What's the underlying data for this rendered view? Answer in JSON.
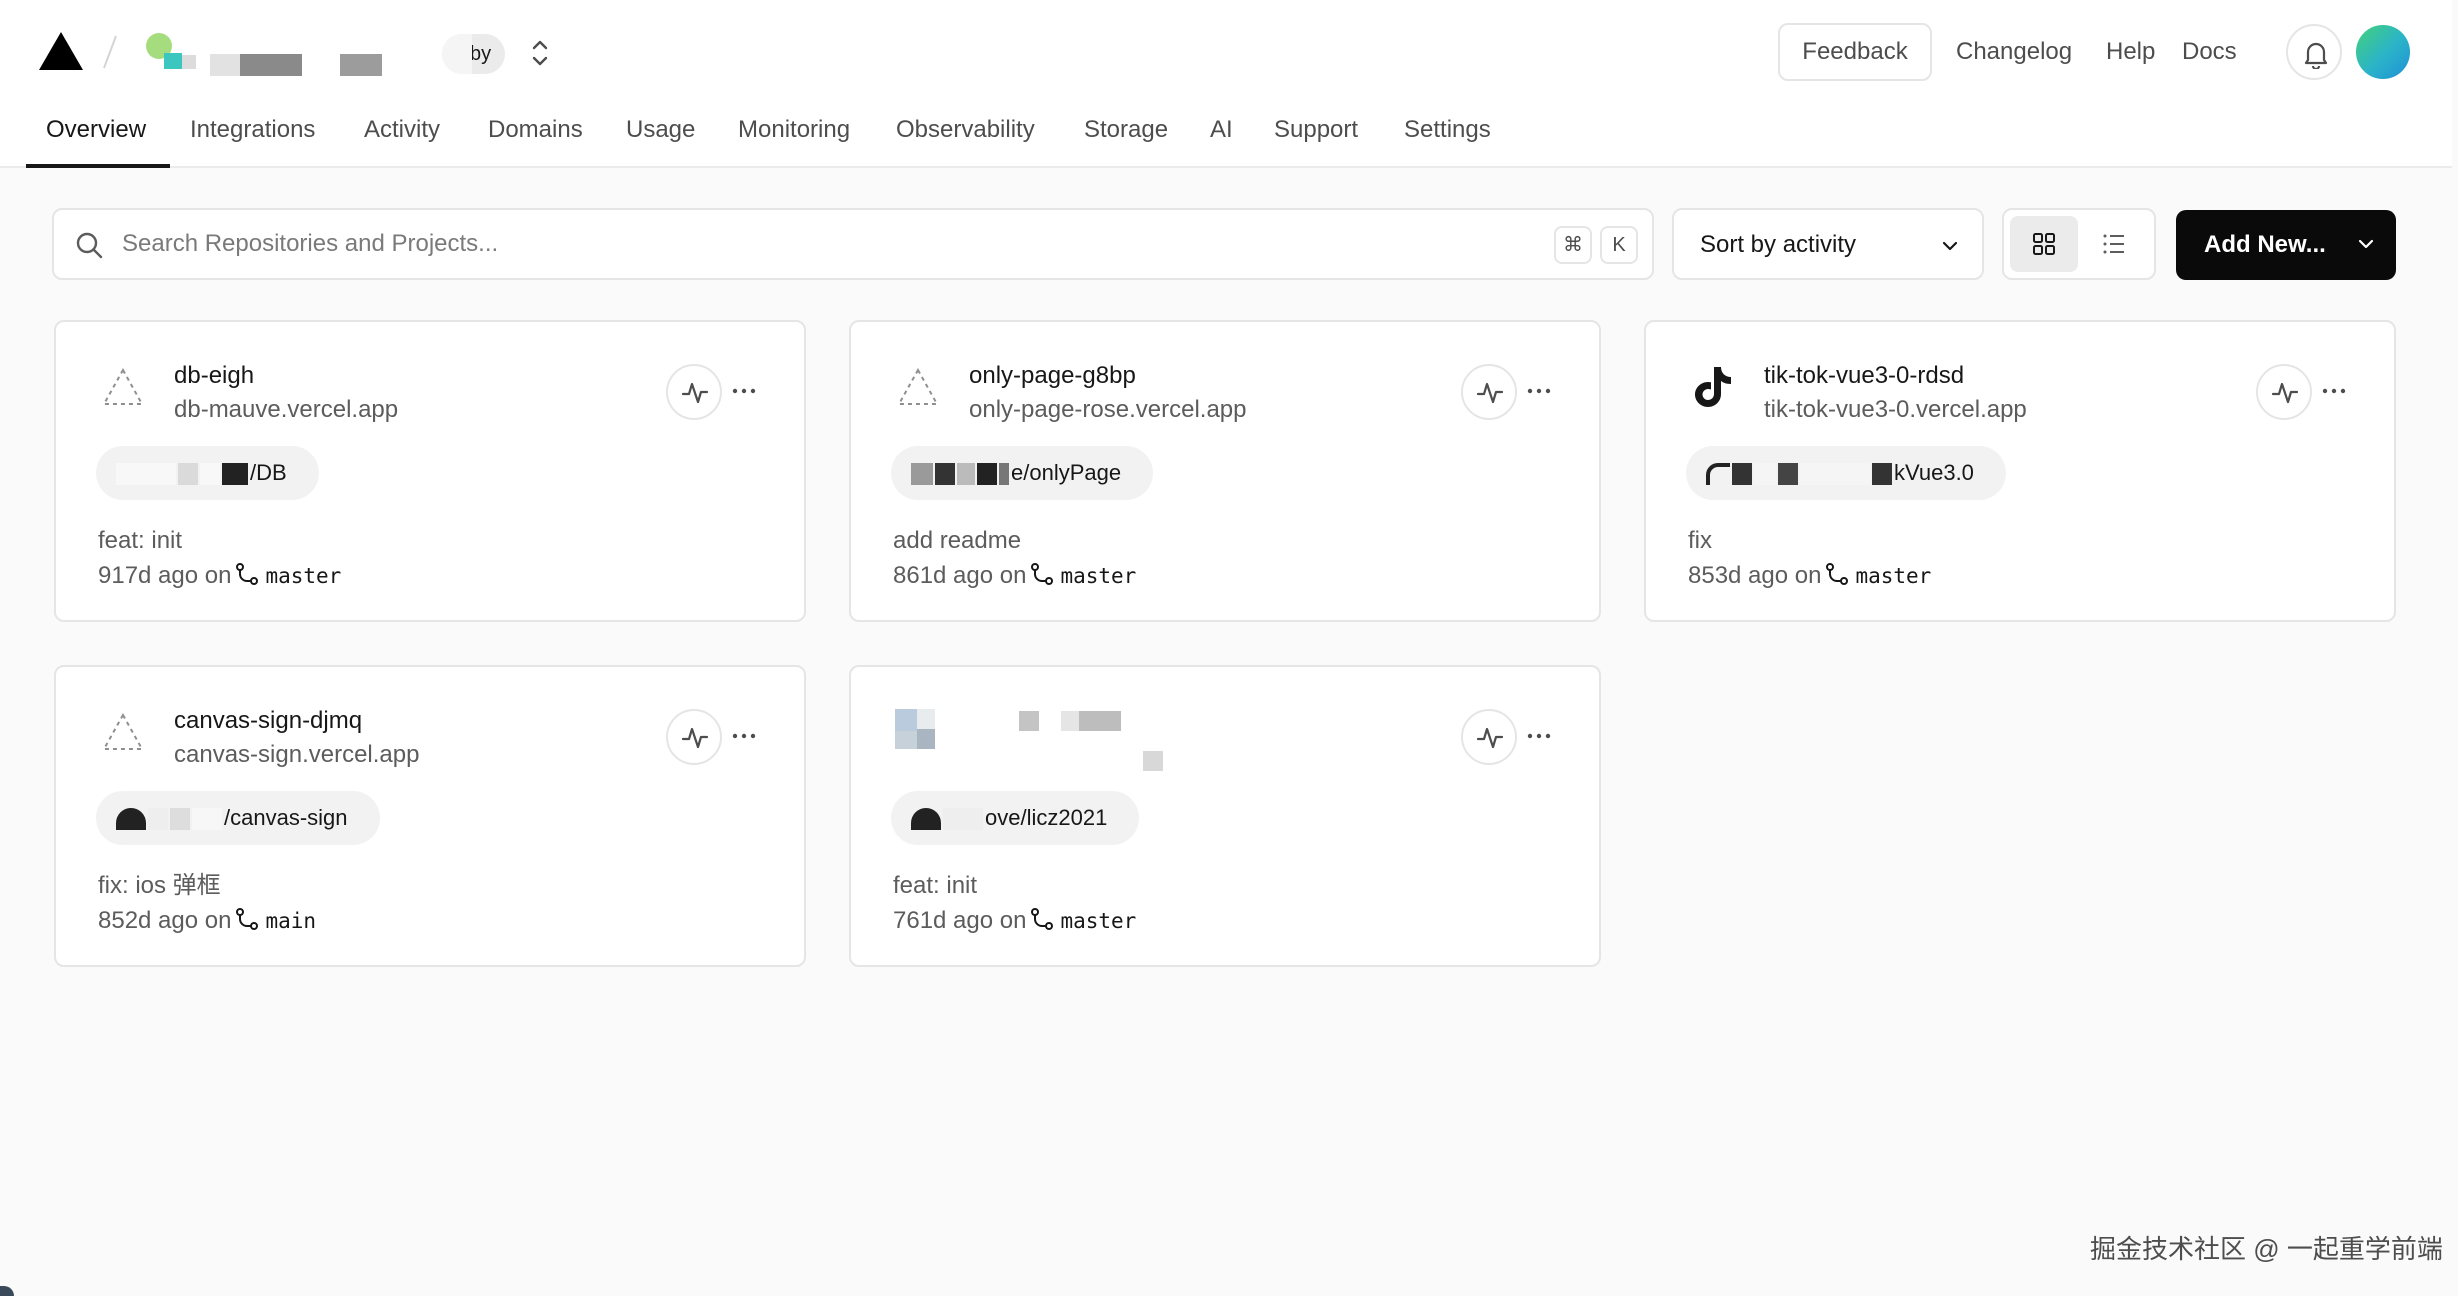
{
  "header": {
    "team_plan_badge": "by",
    "feedback_label": "Feedback",
    "links": [
      "Changelog",
      "Help",
      "Docs"
    ],
    "tabs": [
      "Overview",
      "Integrations",
      "Activity",
      "Domains",
      "Usage",
      "Monitoring",
      "Observability",
      "Storage",
      "AI",
      "Support",
      "Settings"
    ],
    "active_tab": "Overview"
  },
  "toolbar": {
    "search_placeholder": "Search Repositories and Projects...",
    "shortcut_keys": [
      "⌘",
      "K"
    ],
    "sort_label": "Sort by activity",
    "view_mode": "grid",
    "add_new_label": "Add New..."
  },
  "projects": [
    {
      "name": "db-eigh",
      "domain": "db-mauve.vercel.app",
      "icon": "vercel-triangle-outline-icon",
      "repo": "/DB",
      "commit_message": "feat: init",
      "commit_age": "917d ago on",
      "branch": "master"
    },
    {
      "name": "only-page-g8bp",
      "domain": "only-page-rose.vercel.app",
      "icon": "vercel-triangle-outline-icon",
      "repo": "e/onlyPage",
      "commit_message": "add readme",
      "commit_age": "861d ago on",
      "branch": "master"
    },
    {
      "name": "tik-tok-vue3-0-rdsd",
      "domain": "tik-tok-vue3-0.vercel.app",
      "icon": "tiktok-logo-icon",
      "repo": "kVue3.0",
      "commit_message": "fix",
      "commit_age": "853d ago on",
      "branch": "master"
    },
    {
      "name": "canvas-sign-djmq",
      "domain": "canvas-sign.vercel.app",
      "icon": "vercel-triangle-outline-icon",
      "repo": "/canvas-sign",
      "commit_message": "fix: ios 弹框",
      "commit_age": "852d ago on",
      "branch": "main"
    },
    {
      "name": "",
      "domain": "",
      "icon": "pixelated-placeholder-icon",
      "repo": "ove/licz2021",
      "commit_message": "feat: init",
      "commit_age": "761d ago on",
      "branch": "master"
    }
  ],
  "watermark": "掘金技术社区 @ 一起重学前端"
}
